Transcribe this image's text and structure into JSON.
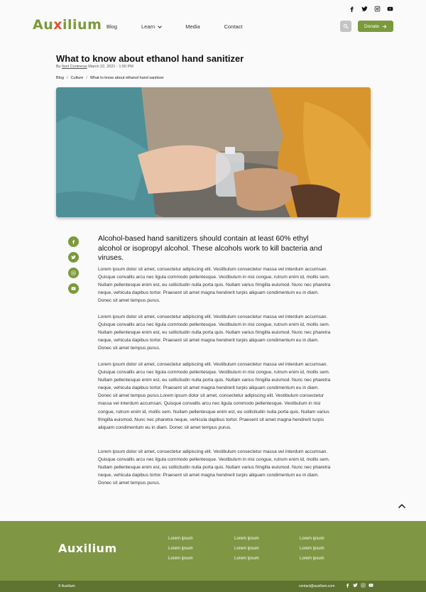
{
  "brand": {
    "logo_pre": "Au",
    "logo_x": "x",
    "logo_post": "ilium",
    "footer_logo": "Auxilium",
    "accent": "#7b9a3c",
    "x_color": "#d9532b"
  },
  "top_social": [
    "facebook-icon",
    "twitter-icon",
    "instagram-icon",
    "youtube-icon"
  ],
  "nav": {
    "items": [
      "Blog",
      "Learn",
      "Media",
      "Contact"
    ],
    "donate_label": "Donate"
  },
  "article": {
    "title": "What to know about ethanol hand sanitizer",
    "byline_prefix": "By",
    "author": "Itzel Contreras",
    "date": "March 22, 2021 - 1:50 PM",
    "breadcrumb": [
      "Blog",
      "Culture",
      "What to know about ethanol hand sanitizer"
    ],
    "lead": "Alcohol-based hand sanitizers should contain at least 60% ethyl alcohol or isopropyl alcohol. These alcohols work to kill bacteria and viruses.",
    "paragraphs": [
      "Lorem ipsum dolor sit amet, consectetur adipiscing elit. Vestibulum consectetur massa vel interdum accumsan. Quisque convallis arcu nec ligula commodo pellentesque. Vestibulum in nisi congue, rutrum enim id, mollis sem. Nullam pellentesque enim est, eu sollicitudin nulla porta quis. Nullam varius fringilla euismod. Nunc nec pharetra neque, vehicula dapibus tortor. Praesent sit amet magna hendrerit turpis aliquam condimentum eu in diam. Donec sit amet tempus purus.",
      "Lorem ipsum dolor sit amet, consectetur adipiscing elit. Vestibulum consectetur massa vel interdum accumsan. Quisque convallis arcu nec ligula commodo pellentesque. Vestibulum in nisi congue, rutrum enim id, mollis sem. Nullam pellentesque enim est, eu sollicitudin nulla porta quis. Nullam varius fringilla euismod. Nunc nec pharetra neque, vehicula dapibus tortor. Praesent sit amet magna hendrerit turpis aliquam condimentum eu in diam. Donec sit amet tempus purus.",
      "Lorem ipsum dolor sit amet, consectetur adipiscing elit. Vestibulum consectetur massa vel interdum accumsan. Quisque convallis arcu nec ligula commodo pellentesque. Vestibulum in nisi congue, rutrum enim id, mollis sem. Nullam pellentesque enim est, eu sollicitudin nulla porta quis. Nullam varius fringilla euismod. Nunc nec pharetra neque, vehicula dapibus tortor. Praesent sit amet magna hendrerit turpis aliquam condimentum eu in diam. Donec sit amet tempus purus.Lorem ipsum dolor sit amet, consectetur adipiscing elit. Vestibulum consectetur massa vel interdum accumsan. Quisque convallis arcu nec ligula commodo pellentesque. Vestibulum in nisi congue, rutrum enim id, mollis sem. Nullam pellentesque enim est, eu sollicitudin nulla porta quis. Nullam varius fringilla euismod. Nunc nec pharetra neque, vehicula dapibus tortor. Praesent sit amet magna hendrerit turpis aliquam condimentum eu in diam. Donec sit amet tempus purus.",
      "Lorem ipsum dolor sit amet, consectetur adipiscing elit. Vestibulum consectetur massa vel interdum accumsan. Quisque convallis arcu nec ligula commodo pellentesque. Vestibulum in nisi congue, rutrum enim id, mollis sem. Nullam pellentesque enim est, eu sollicitudin nulla porta quis. Nullam varius fringilla euismod. Nunc nec pharetra neque, vehicula dapibus tortor. Praesent sit amet magna hendrerit turpis aliquam condimentum eu in diam. Donec sit amet tempus purus."
    ]
  },
  "share_icons": [
    "facebook-icon",
    "twitter-icon",
    "instagram-icon",
    "youtube-icon"
  ],
  "footer": {
    "col1": [
      "Lorem ipsum",
      "Lorem ipsum",
      "Lorem ipsum"
    ],
    "col2": [
      "Lorem ipsum",
      "Lorem ipsum",
      "Lorem ipsum"
    ],
    "col3": [
      "Lorem ipsum",
      "Lorem ipsum",
      "Lorem ipsum"
    ],
    "copyright": "© Auxilium",
    "email": "contact@auxilium.com"
  }
}
